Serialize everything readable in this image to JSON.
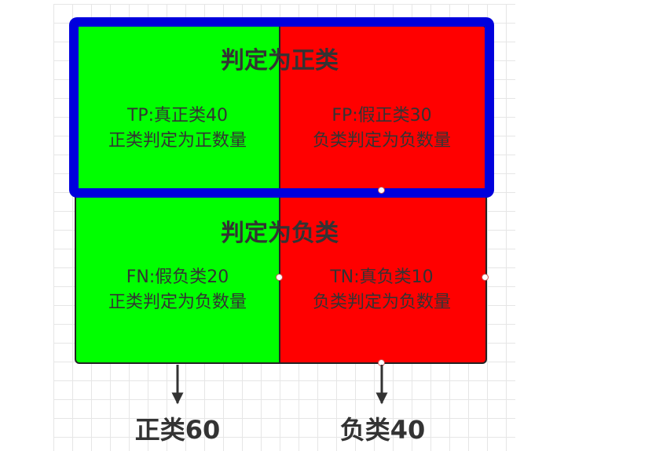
{
  "rows": {
    "top_title": "判定为正类",
    "bottom_title": "判定为负类"
  },
  "cells": [
    {
      "line1": "TP:真正类40",
      "line2": "正类判定为正数量",
      "color": "#00ff00"
    },
    {
      "line1": "FP:假正类30",
      "line2": "负类判定为负数量",
      "color": "#ff0000"
    },
    {
      "line1": "FN:假负类20",
      "line2": "正类判定为负数量",
      "color": "#00ff00"
    },
    {
      "line1": "TN:真负类10",
      "line2": "负类判定为负数量",
      "color": "#ff0000"
    }
  ],
  "totals": {
    "positive": "正类60",
    "negative": "负类40"
  },
  "colors": {
    "selection": "#0000dd",
    "positive": "#00ff00",
    "negative": "#ff0000"
  }
}
